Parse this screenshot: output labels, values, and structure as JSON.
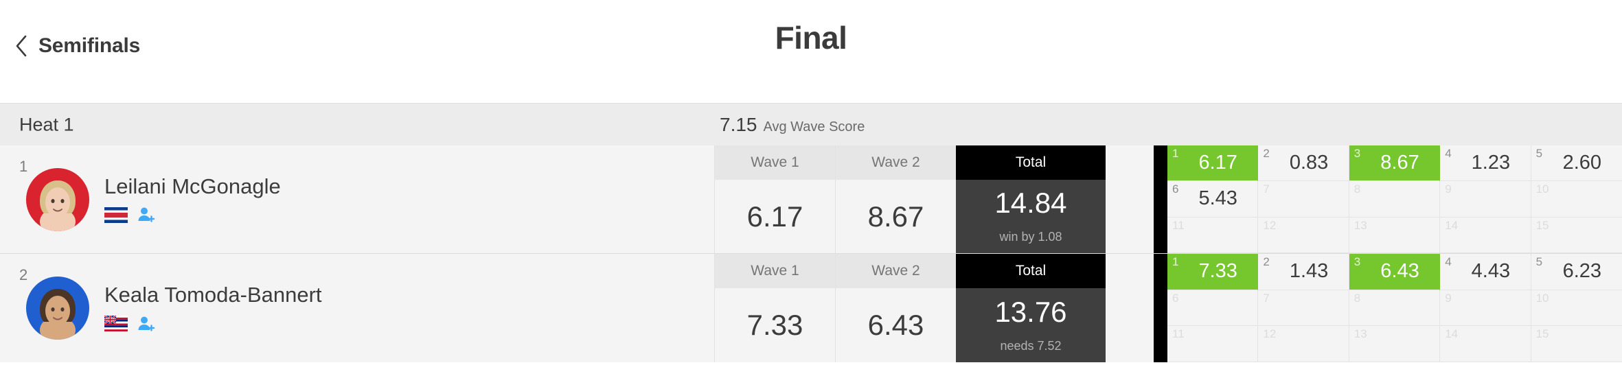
{
  "header": {
    "back_label": "Semifinals",
    "back_icon": "chevron-left-icon",
    "round_title": "Final"
  },
  "heat": {
    "name": "Heat 1",
    "avg_wave_score_value": "7.15",
    "avg_wave_score_label": "Avg Wave Score"
  },
  "columns": {
    "wave1": "Wave 1",
    "wave2": "Wave 2",
    "total": "Total"
  },
  "colors": {
    "counted_wave_green": "#76c72e",
    "total_header_black": "#000000",
    "total_body_dark": "#3f3f3f",
    "band_grey": "#ececec",
    "row_bg": "#f4f4f4"
  },
  "athletes": [
    {
      "rank": "1",
      "name": "Leilani McGonagle",
      "jersey_color": "#d9232e",
      "flag": "costa-rica-flag-icon",
      "follow_icon": "add-user-icon",
      "wave1": "6.17",
      "wave2": "8.67",
      "total": "14.84",
      "note": "win by 1.08",
      "priority_color": "#000000",
      "waves": [
        {
          "n": "1",
          "score": "6.17",
          "counted": true
        },
        {
          "n": "2",
          "score": "0.83",
          "counted": false
        },
        {
          "n": "3",
          "score": "8.67",
          "counted": true
        },
        {
          "n": "4",
          "score": "1.23",
          "counted": false
        },
        {
          "n": "5",
          "score": "2.60",
          "counted": false
        },
        {
          "n": "6",
          "score": "5.43",
          "counted": false
        },
        {
          "n": "7",
          "score": "",
          "counted": false
        },
        {
          "n": "8",
          "score": "",
          "counted": false
        },
        {
          "n": "9",
          "score": "",
          "counted": false
        },
        {
          "n": "10",
          "score": "",
          "counted": false
        },
        {
          "n": "11",
          "score": "",
          "counted": false
        },
        {
          "n": "12",
          "score": "",
          "counted": false
        },
        {
          "n": "13",
          "score": "",
          "counted": false
        },
        {
          "n": "14",
          "score": "",
          "counted": false
        },
        {
          "n": "15",
          "score": "",
          "counted": false
        }
      ]
    },
    {
      "rank": "2",
      "name": "Keala Tomoda-Bannert",
      "jersey_color": "#1f5fd0",
      "flag": "hawaii-flag-icon",
      "follow_icon": "add-user-icon",
      "wave1": "7.33",
      "wave2": "6.43",
      "total": "13.76",
      "note": "needs 7.52",
      "priority_color": "#000000",
      "waves": [
        {
          "n": "1",
          "score": "7.33",
          "counted": true
        },
        {
          "n": "2",
          "score": "1.43",
          "counted": false
        },
        {
          "n": "3",
          "score": "6.43",
          "counted": true
        },
        {
          "n": "4",
          "score": "4.43",
          "counted": false
        },
        {
          "n": "5",
          "score": "6.23",
          "counted": false
        },
        {
          "n": "6",
          "score": "",
          "counted": false
        },
        {
          "n": "7",
          "score": "",
          "counted": false
        },
        {
          "n": "8",
          "score": "",
          "counted": false
        },
        {
          "n": "9",
          "score": "",
          "counted": false
        },
        {
          "n": "10",
          "score": "",
          "counted": false
        },
        {
          "n": "11",
          "score": "",
          "counted": false
        },
        {
          "n": "12",
          "score": "",
          "counted": false
        },
        {
          "n": "13",
          "score": "",
          "counted": false
        },
        {
          "n": "14",
          "score": "",
          "counted": false
        },
        {
          "n": "15",
          "score": "",
          "counted": false
        }
      ]
    }
  ]
}
